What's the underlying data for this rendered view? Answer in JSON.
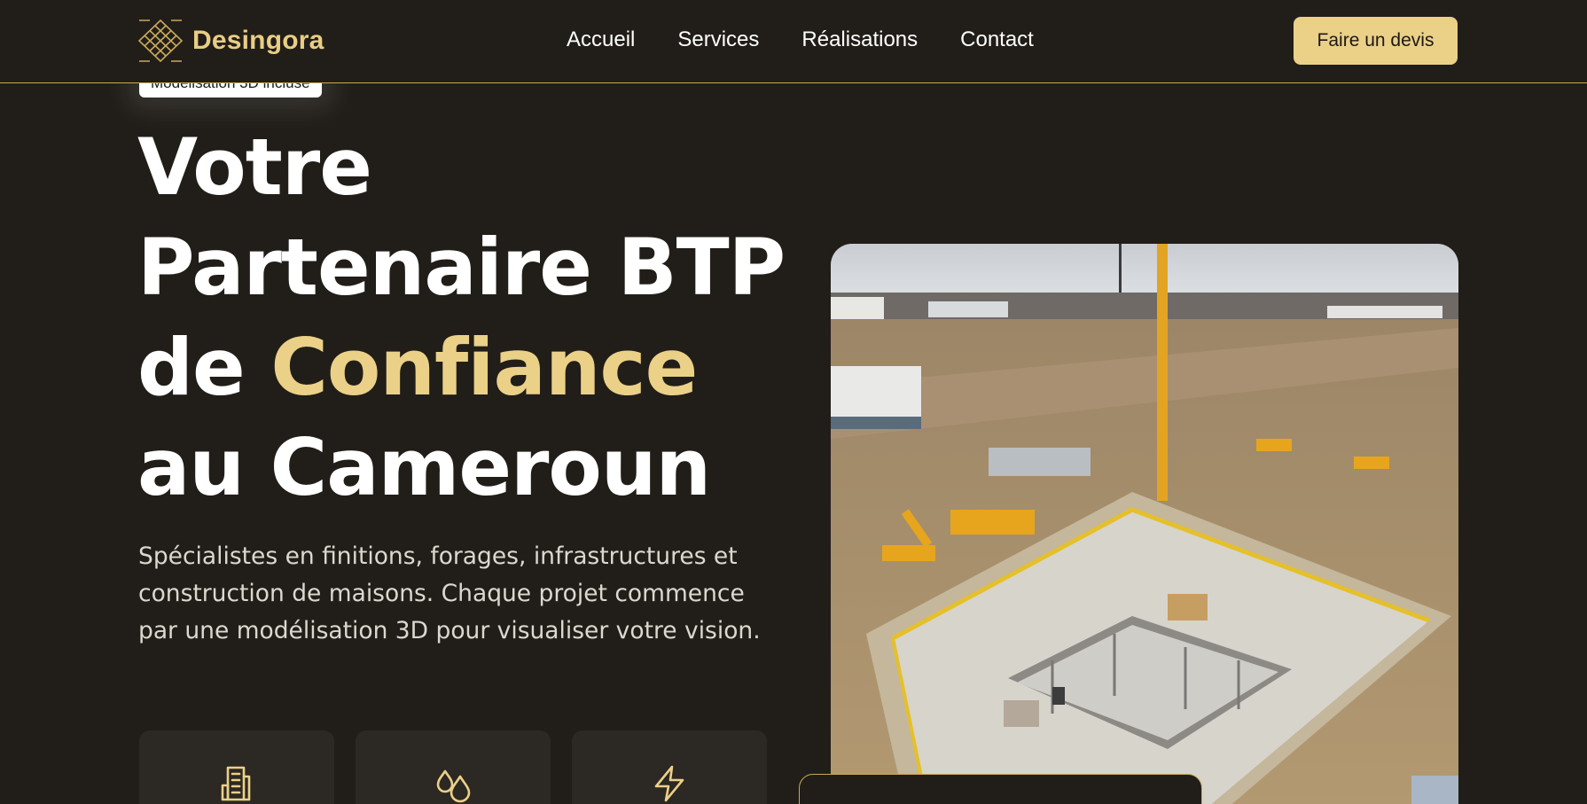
{
  "brand": {
    "name": "Desingora",
    "logo_icon": "diamond-lattice-logo"
  },
  "nav": {
    "items": [
      {
        "label": "Accueil"
      },
      {
        "label": "Services"
      },
      {
        "label": "Réalisations"
      },
      {
        "label": "Contact"
      }
    ],
    "cta_label": "Faire un devis"
  },
  "hero": {
    "badge": "Modélisation 3D incluse",
    "title": {
      "line1": "Votre",
      "line2": "Partenaire BTP",
      "line3_prefix": "de ",
      "line3_accent": "Confiance",
      "line4": "au Cameroun"
    },
    "description": "Spécialistes en finitions, forages, infrastructures et construction de maisons. Chaque projet commence par une modélisation 3D pour visualiser votre vision.",
    "image_subject": "construction-site-aerial-photo"
  },
  "features": [
    {
      "icon": "building-document-icon"
    },
    {
      "icon": "water-drops-icon"
    },
    {
      "icon": "lightning-bolt-icon"
    }
  ],
  "colors": {
    "background": "#211e19",
    "accent": "#ebd088",
    "card": "#2c2823",
    "border": "#c9a95a"
  }
}
